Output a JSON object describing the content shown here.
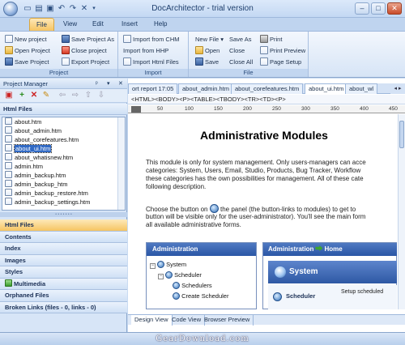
{
  "window": {
    "title": "DocArchitector - trial version",
    "quick_access": [
      "new-icon",
      "open-icon",
      "save-icon",
      "undo-icon",
      "redo-icon",
      "close-icon"
    ]
  },
  "ribbon_tabs": [
    "File",
    "View",
    "Edit",
    "Insert",
    "Help"
  ],
  "ribbon": {
    "project_group": {
      "label": "Project",
      "buttons": [
        "New project",
        "Open Project",
        "Save Project",
        "Save Project As",
        "Close project",
        "Export Project"
      ]
    },
    "import_group": {
      "label": "Import",
      "buttons": [
        "Import from CHM",
        "Import from HHP",
        "Import Html Files"
      ]
    },
    "file_group": {
      "label": "File",
      "buttons": [
        "New File",
        "Open",
        "Save",
        "Save As",
        "Close",
        "Close All",
        "Print",
        "Print Preview",
        "Page Setup"
      ]
    }
  },
  "project_manager": {
    "title": "Project Manager",
    "section": "Html Files",
    "files": [
      "about.htm",
      "about_admin.htm",
      "about_corefeatures.htm",
      "about_ui.htm",
      "about_whatisnew.htm",
      "admin.htm",
      "admin_backup.htm",
      "admin_backup_htm",
      "admin_backup_restore.htm",
      "admin_backup_settings.htm"
    ],
    "selected_file": "about_ui.htm",
    "nav": [
      "Html Files",
      "Contents",
      "Index",
      "Images",
      "Styles",
      "Multimedia",
      "Orphaned Files",
      "Broken Links (files - 0, links - 0)"
    ],
    "active_nav": "Html Files"
  },
  "document": {
    "tabs": [
      "ort report 17:05",
      "about_admin.htm",
      "about_corefeatures.htm",
      "about_ui.htm",
      "about_wl"
    ],
    "active_tab": "about_ui.htm",
    "tag_path": "<HTML><BODY><P><TABLE><TBODY><TR><TD><P>",
    "ruler_labels": [
      "50",
      "100",
      "150",
      "200",
      "250",
      "300",
      "350",
      "400",
      "450"
    ],
    "page": {
      "heading": "Administrative Modules",
      "para1": [
        "This module is only for system management. Only users-managers can acce",
        "categories: System, Users, Email, Studio, Products, Bug Tracker, Workflow",
        "these categories has the own possibilities for management. All of these cate",
        "following description."
      ],
      "para2_before_icon": "Choose the button on",
      "para2_after_icon": "the panel (the button-links to modules) to get to",
      "para2_rest": [
        "button will be visible only for the user-administrator). You'll see the main form",
        "all available administrative forms."
      ],
      "admin_panel": {
        "title": "Administration",
        "tree": [
          "System",
          "Scheduler",
          "Schedulers",
          "Create Scheduler"
        ]
      },
      "home_panel": {
        "title_left": "Administration",
        "title_right": "Home",
        "system_label": "System",
        "scheduler_label": "Scheduler",
        "scheduler_desc": "Setup scheduled"
      }
    },
    "bottom_tabs": [
      "Design View",
      "Code View",
      "Browser Preview"
    ],
    "active_bottom_tab": "Design View"
  },
  "watermark": "GearDownload.com"
}
